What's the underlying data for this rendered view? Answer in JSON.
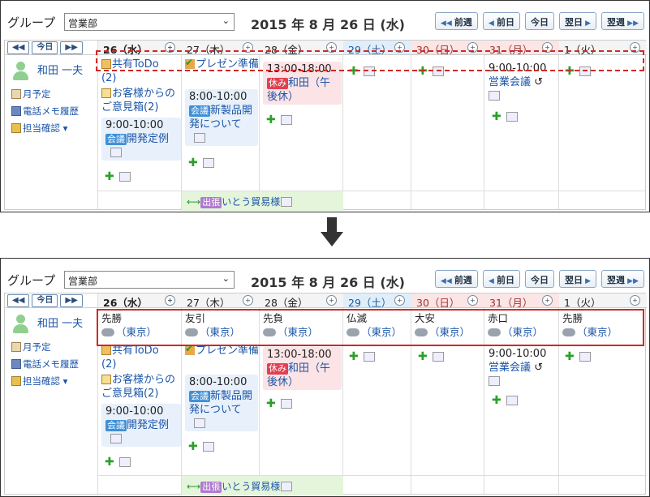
{
  "header": {
    "group_label": "グループ",
    "group_select": "営業部",
    "date_title": "2015 年 8 月 26 日 (水)",
    "nav": [
      "前週",
      "前日",
      "今日",
      "翌日",
      "翌週"
    ]
  },
  "left": {
    "prev": "◀◀",
    "today": "今日",
    "next": "▶▶",
    "user_name": "和田 一夫",
    "links": [
      "月予定",
      "電話メモ履歴",
      "担当確認"
    ]
  },
  "days": [
    {
      "label": "26（水）",
      "type": "today"
    },
    {
      "label": "27（木）",
      "type": "weekday"
    },
    {
      "label": "28（金）",
      "type": "weekday"
    },
    {
      "label": "29（土）",
      "type": "sat"
    },
    {
      "label": "30（日）",
      "type": "sun"
    },
    {
      "label": "31（月）",
      "type": "weekday"
    },
    {
      "label": "1（火）",
      "type": "weekday"
    }
  ],
  "events": {
    "todo": "共有ToDo",
    "todo_count": "(2)",
    "okyaku": "お客様からのご意見箱(2)",
    "ev1_time": "9:00-10:00",
    "ev1_tag": "会議",
    "ev1_title": "開発定例",
    "presen": "プレゼン準備",
    "ev2_time": "8:00-10:00",
    "ev2_tag": "会議",
    "ev2_title": "新製品開発について",
    "ev3_time": "13:00-18:00",
    "ev3_tag": "休み",
    "ev3_title": "和田（午後休）",
    "ev4_time": "9:00-10:00",
    "ev4_title": "営業会議",
    "shutcho_tag": "出張",
    "shutcho_title": "いとう貿易様"
  },
  "rokuyo": [
    {
      "name": "先勝",
      "loc": "（東京）"
    },
    {
      "name": "友引",
      "loc": "（東京）"
    },
    {
      "name": "先負",
      "loc": "（東京）"
    },
    {
      "name": "仏滅",
      "loc": "（東京）"
    },
    {
      "name": "大安",
      "loc": "（東京）"
    },
    {
      "name": "赤口",
      "loc": "（東京）"
    },
    {
      "name": "先勝",
      "loc": "（東京）"
    }
  ]
}
